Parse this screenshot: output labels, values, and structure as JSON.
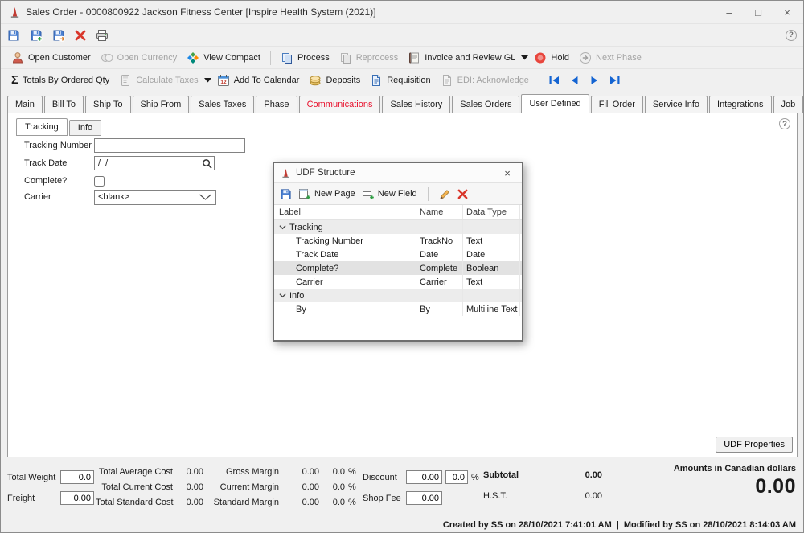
{
  "glyphs": {
    "sigma": "Σ",
    "help": "?",
    "minimize": "–",
    "maximize": "□",
    "close": "×"
  },
  "titlebar": {
    "title": "Sales Order - 0000800922 Jackson Fitness Center [Inspire Health System (2021)]"
  },
  "toolbar_actions": {
    "open_customer": "Open Customer",
    "open_currency": "Open Currency",
    "view_compact": "View Compact",
    "process": "Process",
    "reprocess": "Reprocess",
    "invoice_review_gl": "Invoice and Review GL",
    "hold": "Hold",
    "next_phase": "Next Phase"
  },
  "toolbar_tools": {
    "totals_by_ordered_qty": "Totals By Ordered Qty",
    "calculate_taxes": "Calculate Taxes",
    "add_to_calendar": "Add To Calendar",
    "deposits": "Deposits",
    "requisition": "Requisition",
    "edi_acknowledge": "EDI: Acknowledge"
  },
  "tabs": [
    "Main",
    "Bill To",
    "Ship To",
    "Ship From",
    "Sales Taxes",
    "Phase",
    "Communications",
    "Sales History",
    "Sales Orders",
    "User Defined",
    "Fill Order",
    "Service Info",
    "Integrations",
    "Job"
  ],
  "subtabs": [
    "Tracking",
    "Info"
  ],
  "form": {
    "tracking_number": {
      "label": "Tracking Number",
      "value": ""
    },
    "track_date": {
      "label": "Track Date",
      "value": "/  /"
    },
    "complete": {
      "label": "Complete?"
    },
    "carrier": {
      "label": "Carrier",
      "value": "<blank>"
    }
  },
  "udf_dialog": {
    "title": "UDF Structure",
    "new_page": "New Page",
    "new_field": "New Field",
    "columns": {
      "label": "Label",
      "name": "Name",
      "type": "Data Type"
    },
    "rows": [
      {
        "label": "Tracking",
        "group": true
      },
      {
        "label": "Tracking Number",
        "name": "TrackNo",
        "type": "Text"
      },
      {
        "label": "Track Date",
        "name": "Date",
        "type": "Date"
      },
      {
        "label": "Complete?",
        "name": "Complete",
        "type": "Boolean"
      },
      {
        "label": "Carrier",
        "name": "Carrier",
        "type": "Text"
      },
      {
        "label": "Info",
        "group": true
      },
      {
        "label": "By",
        "name": "By",
        "type": "Multiline Text"
      }
    ]
  },
  "udf_properties": "UDF Properties",
  "totals": {
    "total_weight": {
      "label": "Total Weight",
      "value": "0.0"
    },
    "freight": {
      "label": "Freight",
      "value": "0.00"
    },
    "total_average_cost": {
      "label": "Total Average Cost",
      "value": "0.00"
    },
    "total_current_cost": {
      "label": "Total Current Cost",
      "value": "0.00"
    },
    "total_standard_cost": {
      "label": "Total Standard Cost",
      "value": "0.00"
    },
    "gross_margin": {
      "label": "Gross Margin",
      "value": "0.00",
      "pct": "0.0",
      "pct_sign": "%"
    },
    "current_margin": {
      "label": "Current Margin",
      "value": "0.00",
      "pct": "0.0",
      "pct_sign": "%"
    },
    "standard_margin": {
      "label": "Standard Margin",
      "value": "0.00",
      "pct": "0.0",
      "pct_sign": "%"
    },
    "discount": {
      "label": "Discount",
      "value": "0.00",
      "pct": "0.0",
      "pct_sign": "%"
    },
    "shop_fee": {
      "label": "Shop Fee",
      "value": "0.00"
    },
    "subtotal": {
      "label": "Subtotal",
      "value": "0.00"
    },
    "hst": {
      "label": "H.S.T.",
      "value": "0.00"
    },
    "currency_note": "Amounts in Canadian dollars",
    "grand_total": "0.00"
  },
  "statusbar": {
    "created": "Created by SS on 28/10/2021 7:41:01 AM",
    "separator": "|",
    "modified": "Modified by SS on 28/10/2021 8:14:03 AM"
  },
  "colors": {
    "accent_blue": "#1b66c9",
    "alert_red": "#e8112d",
    "hold_red": "#e8453c",
    "disabled_text": "#a3a3a3"
  }
}
